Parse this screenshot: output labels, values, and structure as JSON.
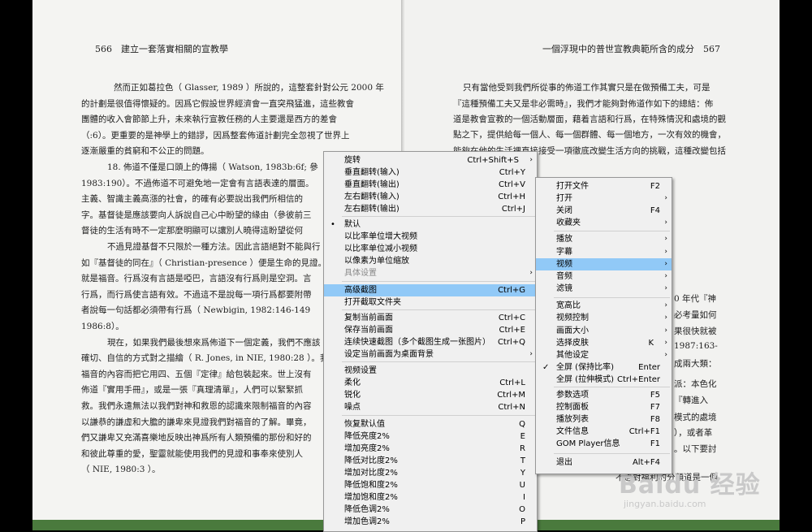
{
  "book": {
    "left_header": "566　建立一套落實相關的宣教學",
    "right_header": "一個浮現中的普世宣教典範所含的成分　567",
    "left_lines": [
      "然而正如葛拉色（ Glasser, 1989 ）所說的，這整套針對公元 2000 年",
      "的計劃是很值得懷疑的。因爲它假設世界經濟會一直突飛猛進，這些教會",
      "團體的收入會節節上升，未來執行宣教任務的人主要還是西方的差會",
      "（:6）。更重要的是神學上的錯謬，因爲整套佈道計劃完全忽視了世界上",
      "逐漸嚴重的貧窮和不公正的問題。",
      "18. 佈道不僅是口頭上的傳揚（ Watson, 1983b:6f; 參",
      "1983:190）。不過佈道不可避免地一定會有言語表達的層面。",
      "主義、智識主義高漲的社會，的確有必要說出我們所相信的",
      "字。基督徒是應該要向人訴說自己心中盼望的緣由（參彼前三",
      "督徒的生活有時不一定那麼明顯可以讓別人曉得這盼望從何",
      "不過見證基督不只限於一種方法。因此言語絕對不能與行",
      "如『基督徒的同在』（ Christian-presence ）便是生命的見證。",
      "就是福音。行爲沒有言語是啞巴，言語沒有行爲則是空洞。言",
      "行爲，而行爲使言語有效。不過這不是說每一項行爲都要附帶",
      "者說每一句話都必須帶有行爲（ Newbigin, 1982:146-149",
      "1986:8）。",
      "現在，如果我們最後想來爲佈道下一個定義，我們不應該",
      "確切、自信的方式對之描繪（ R. Jones, in NIE, 1980:28 ）。我",
      "福音的內容而把它用四、五個『定律』給包裝起來。世上沒有",
      "佈道『實用手冊』，或是一張『真理清單』，人們可以緊緊抓",
      "救。我們永遠無法以我們對神和救恩的認識來限制福音的內容",
      "以謙恭的謙虛和大膽的謙卑來見證我們對福音的了解。畢竟，",
      "們又謙卑又充滿喜樂地反映出神爲所有人類預備的那份和好的",
      "和彼此尊重的愛，聖靈就能使用我們的見證和事奉來使別人",
      "（ NIE, 1980:3 ）。"
    ],
    "right_lines": [
      "只有當他受到我們所從事的佈道工作其實只是在做預備工夫，可是",
      "『這種預備工夫又是非必需時』，我們才能夠對佈道作如下的總結：佈",
      "道是教會宣教的一個活動層面，藉着言語和行爲，在特殊情況和處境的觀",
      "點之下，提供給每一個人、每一個群體、每一個地方，一次有效的機會，",
      "能夠在他的生活裡直接接受一項徹底改變生活方向的挑戰，這種改變包括",
      "0 年代『神",
      "必考量如何",
      "果很快就被",
      "1987:163-",
      "成兩大類：",
      "派：本色化",
      "『轉進入",
      "模式的處境",
      "），或者革",
      "。以下要討",
      "不過對福利的分類道是一個"
    ],
    "watermark_big": "Baidu 经验",
    "watermark_small": "jingyan.baidu.com"
  },
  "context_menu": {
    "items": [
      {
        "label": "旋转",
        "shortcut": "Ctrl+Shift+S",
        "arrow": "›"
      },
      {
        "label": "垂直翻转(输入)",
        "shortcut": "Ctrl+Y"
      },
      {
        "label": "垂直翻转(输出)",
        "shortcut": "Ctrl+V"
      },
      {
        "label": "左右翻转(输入)",
        "shortcut": "Ctrl+H"
      },
      {
        "label": "左右翻转(输出)",
        "shortcut": "Ctrl+J"
      },
      {
        "label": "默认",
        "mark": "•"
      },
      {
        "label": "以比率单位增大视频"
      },
      {
        "label": "以比率单位减小视频"
      },
      {
        "label": "以像素为单位缩放"
      },
      {
        "label": "具体设置",
        "arrow": "›",
        "disabled": true
      },
      {
        "label": "高级截图",
        "shortcut": "Ctrl+G",
        "highlighted": true
      },
      {
        "label": "打开截取文件夹"
      },
      {
        "label": "复制当前画面",
        "shortcut": "Ctrl+C"
      },
      {
        "label": "保存当前画面",
        "shortcut": "Ctrl+E"
      },
      {
        "label": "连续快速截图（多个截图生成一张图片）",
        "shortcut": "Ctrl+Q"
      },
      {
        "label": "设定当前画面为桌面背景",
        "arrow": "›"
      },
      {
        "label": "视频设置"
      },
      {
        "label": "柔化",
        "shortcut": "Ctrl+L"
      },
      {
        "label": "锐化",
        "shortcut": "Ctrl+M"
      },
      {
        "label": "噪点",
        "shortcut": "Ctrl+N"
      },
      {
        "label": "恢复默认值",
        "shortcut": "Q"
      },
      {
        "label": "降低亮度2%",
        "shortcut": "E"
      },
      {
        "label": "增加亮度2%",
        "shortcut": "R"
      },
      {
        "label": "降低对比度2%",
        "shortcut": "T"
      },
      {
        "label": "增加对比度2%",
        "shortcut": "Y"
      },
      {
        "label": "降低饱和度2%",
        "shortcut": "U"
      },
      {
        "label": "增加饱和度2%",
        "shortcut": "I"
      },
      {
        "label": "降低色调2%",
        "shortcut": "O"
      },
      {
        "label": "增加色调2%",
        "shortcut": "P"
      }
    ]
  },
  "sub_menu": {
    "items": [
      {
        "label": "打开文件",
        "shortcut": "F2"
      },
      {
        "label": "打开",
        "arrow": "›"
      },
      {
        "label": "关闭",
        "shortcut": "F4"
      },
      {
        "label": "收藏夹",
        "arrow": "›"
      },
      {
        "label": "播放",
        "arrow": "›"
      },
      {
        "label": "字幕",
        "arrow": "›"
      },
      {
        "label": "视频",
        "arrow": "›",
        "highlighted": true
      },
      {
        "label": "音频",
        "arrow": "›"
      },
      {
        "label": "滤镜",
        "arrow": "›"
      },
      {
        "label": "宽高比",
        "arrow": "›"
      },
      {
        "label": "视频控制",
        "arrow": "›"
      },
      {
        "label": "画面大小",
        "arrow": "›"
      },
      {
        "label": "选择皮肤",
        "shortcut": "K",
        "arrow": "›"
      },
      {
        "label": "其他设定",
        "arrow": "›"
      },
      {
        "label": "全屏 (保持比率)",
        "shortcut": "Enter",
        "mark": "✓"
      },
      {
        "label": "全屏 (拉伸模式)",
        "shortcut": "Ctrl+Enter"
      },
      {
        "label": "参数选项",
        "shortcut": "F5"
      },
      {
        "label": "控制面板",
        "shortcut": "F7"
      },
      {
        "label": "播放列表",
        "shortcut": "F8"
      },
      {
        "label": "文件信息",
        "shortcut": "Ctrl+F1"
      },
      {
        "label": "GOM Player信息",
        "shortcut": "F1"
      },
      {
        "label": "退出",
        "shortcut": "Alt+F4"
      }
    ]
  },
  "colors": {
    "highlight": "#91c9f7",
    "menu_bg": "#f0f0f0",
    "green_bar": "#4a7a3d"
  }
}
